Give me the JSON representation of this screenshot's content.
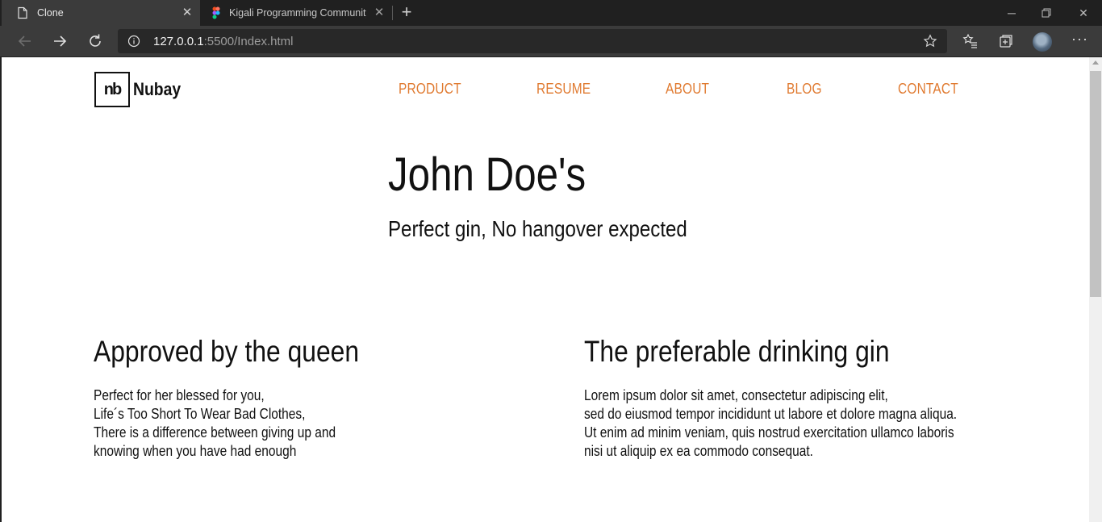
{
  "browser": {
    "tabs": [
      {
        "title": "Clone",
        "active": true
      },
      {
        "title": "Kigali Programming Community",
        "active": false
      }
    ],
    "address": {
      "host": "127.0.0.1",
      "rest": ":5500/Index.html"
    },
    "icons": {
      "back": "arrow-left-icon",
      "forward": "arrow-right-icon",
      "refresh": "refresh-icon",
      "info": "info-icon",
      "favorite": "star-icon",
      "favorites": "favorites-list-icon",
      "collections": "collections-icon",
      "more": "more-icon"
    }
  },
  "site": {
    "logo": {
      "mark": "nb",
      "name": "Nubay"
    },
    "nav": [
      "PRODUCT",
      "RESUME",
      "ABOUT",
      "BLOG",
      "CONTACT"
    ],
    "accent_color": "#e07a30",
    "hero": {
      "title": "John Doe's",
      "subtitle": "Perfect gin, No hangover expected"
    },
    "features": [
      {
        "heading": "Approved by the queen",
        "lines": [
          "Perfect for her blessed for you,",
          "Life´s Too Short To Wear Bad Clothes,",
          "There is a difference between giving up and",
          "knowing when you have had enough"
        ]
      },
      {
        "heading": "The preferable drinking gin",
        "lines": [
          "Lorem ipsum dolor sit amet, consectetur adipiscing elit,",
          "sed do eiusmod tempor incididunt ut labore et dolore magna aliqua.",
          "Ut enim ad minim veniam, quis nostrud exercitation ullamco laboris",
          "nisi ut aliquip ex ea commodo consequat."
        ]
      }
    ]
  }
}
